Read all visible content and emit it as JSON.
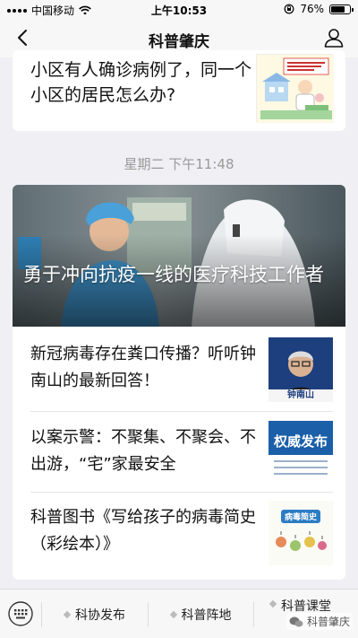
{
  "status_bar": {
    "carrier": "中国移动",
    "time": "上午10:53",
    "battery": "76%"
  },
  "nav": {
    "title": "科普肇庆"
  },
  "top_card": {
    "title": "小区有人确诊病例了，同一个小区的居民怎么办?"
  },
  "timestamp": "星期二 下午11:48",
  "main_card": {
    "hero_title": "勇于冲向抗疫一线的医疗科技工作者",
    "items": [
      {
        "title": "新冠病毒存在粪口传播？听听钟南山的最新回答！",
        "thumb_caption": "钟南山"
      },
      {
        "title": "以案示警：不聚集、不聚会、不出游，“宅”家最安全",
        "thumb_caption": "权威发布"
      },
      {
        "title": "科普图书《写给孩子的病毒简史（彩绘本）》",
        "thumb_caption": "病毒简史"
      }
    ]
  },
  "bottom_menu": {
    "items": [
      "科协发布",
      "科普阵地",
      "科普课堂"
    ],
    "watermark": "科普肇庆"
  }
}
